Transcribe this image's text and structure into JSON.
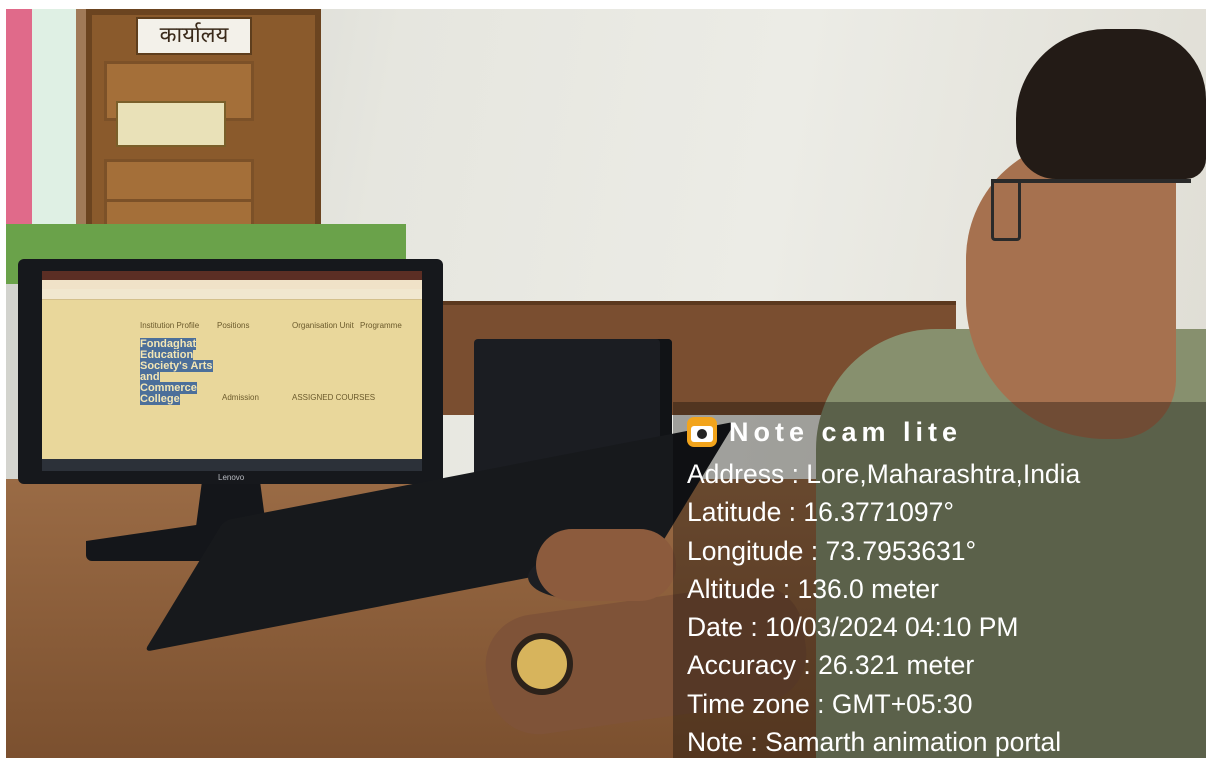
{
  "overlay": {
    "app_name": "Note cam lite",
    "app_icon": "camera-icon",
    "lines": [
      "Address : Lore,Maharashtra,India",
      "Latitude : 16.3771097°",
      "Longitude : 73.7953631°",
      "Altitude : 136.0 meter",
      "Date : 10/03/2024 04:10 PM",
      "Accuracy : 26.321 meter",
      "Time zone : GMT+05:30",
      "Note : Samarth animation portal"
    ],
    "text_color": "#ffffff",
    "icon_color": "#f2a41c"
  },
  "scene": {
    "door_sign": "कार्यालय",
    "monitor_brand": "Lenovo",
    "screen_text": {
      "heading1": "Institution Profile",
      "heading2": "Positions",
      "heading3": "Organisation Unit",
      "heading4": "Programme",
      "college_name": "Fondaghat Education Society's Arts and Commerce College",
      "admission": "Admission",
      "assigned": "ASSIGNED COURSES"
    }
  }
}
